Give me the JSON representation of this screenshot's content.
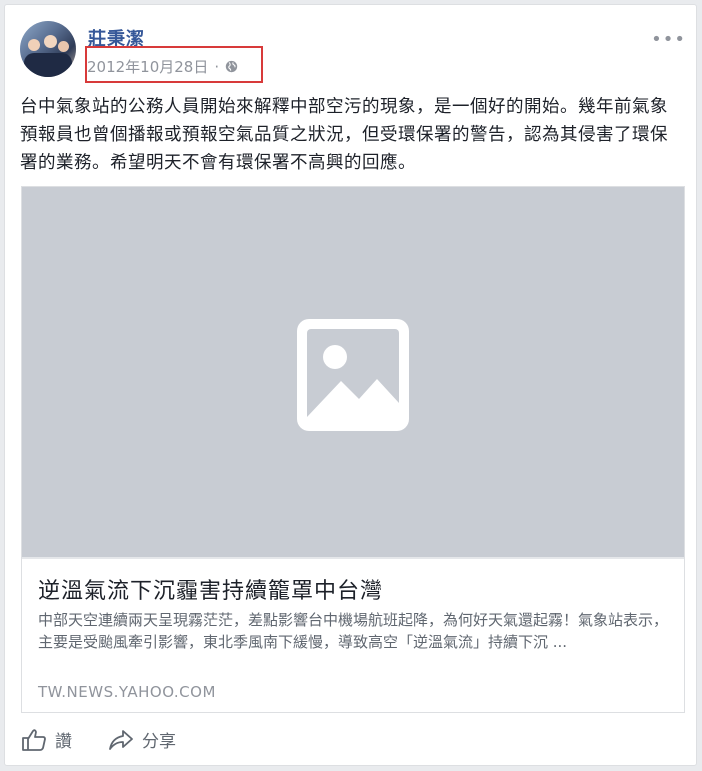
{
  "post": {
    "author": "莊秉潔",
    "date": "2012年10月28日",
    "separator": "·",
    "text": "台中氣象站的公務人員開始來解釋中部空污的現象，是一個好的開始。幾年前氣象預報員也曾個播報或預報空氣品質之狀況，但受環保署的警告，認為其侵害了環保署的業務。希望明天不會有環保署不高興的回應。",
    "more_icon": "more-options-icon",
    "privacy_icon": "globe-icon"
  },
  "link_card": {
    "title": "逆溫氣流下沉霾害持續籠罩中台灣",
    "description": "中部天空連續兩天呈現霧茫茫，差點影響台中機場航班起降，為何好天氣還起霧！氣象站表示，主要是受颱風牽引影響，東北季風南下緩慢，導致高空「逆溫氣流」持續下沉 ...",
    "domain": "TW.NEWS.YAHOO.COM",
    "image_icon": "image-placeholder-icon"
  },
  "actions": {
    "like_label": "讚",
    "share_label": "分享"
  },
  "colors": {
    "highlight_box": "#d83a3a",
    "author_link": "#365899",
    "image_placeholder_bg": "#c8ccd3"
  }
}
